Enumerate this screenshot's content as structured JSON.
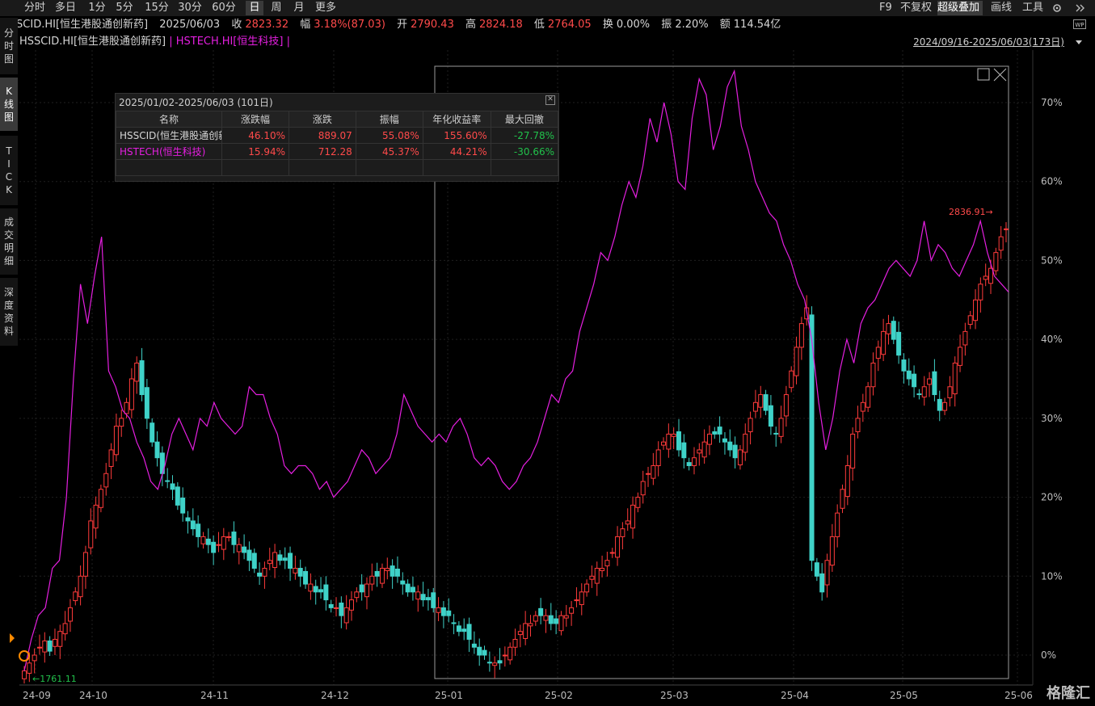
{
  "toolbar": {
    "periods": [
      "分时",
      "多日",
      "1分",
      "5分",
      "15分",
      "30分",
      "60分",
      "日",
      "周",
      "月",
      "更多"
    ],
    "active_period": "日",
    "right": [
      "F9",
      "不复权",
      "超级叠加",
      "画线",
      "工具"
    ],
    "right_active": "超级叠加"
  },
  "info": {
    "name": "HSSCID.HI[恒生港股通创新药]",
    "date": "2025/06/03",
    "close_label": "收",
    "close": "2823.32",
    "chg_label": "幅",
    "chg": "3.18%(87.03)",
    "open_label": "开",
    "open": "2790.43",
    "high_label": "高",
    "high": "2824.18",
    "low_label": "低",
    "low": "2764.05",
    "turn_label": "换",
    "turn": "0.00%",
    "amp_label": "振",
    "amp": "2.20%",
    "amt_label": "额",
    "amt": "114.54亿"
  },
  "legend": {
    "main": "HSSCID.HI[恒生港股通创新药]",
    "sep": " | ",
    "overlay": "HSTECH.HI[恒生科技]",
    "end": " |",
    "range": "2024/09/16-2025/06/03(173日)"
  },
  "leftnav": [
    {
      "label": "分时图",
      "active": false
    },
    {
      "label": "K线图",
      "active": true
    },
    {
      "label": "TICK",
      "active": false
    },
    {
      "label": "成交明细",
      "active": false
    },
    {
      "label": "深度资料",
      "active": false
    }
  ],
  "summary": {
    "title": "2025/01/02-2025/06/03 (101日)",
    "headers": [
      "名称",
      "涨跌幅",
      "涨跌",
      "振幅",
      "年化收益率",
      "最大回撤"
    ],
    "rows": [
      {
        "name": "HSSCID(恒生港股通创新药)",
        "chg_pct": "46.10%",
        "chg": "889.07",
        "amp": "55.08%",
        "annual": "155.60%",
        "mdd": "-27.78%"
      },
      {
        "name": "HSTECH(恒生科技)",
        "chg_pct": "15.94%",
        "chg": "712.28",
        "amp": "45.37%",
        "annual": "44.21%",
        "mdd": "-30.66%"
      }
    ]
  },
  "colors": {
    "up": "#ff3b3b",
    "down": "#3fd2c8",
    "overlay": "#e51fe0",
    "grid": "#1e1e1e"
  },
  "watermark": "格隆汇",
  "chart_data": {
    "type": "candlestick-with-overlay",
    "x_ticks": [
      "24-09",
      "24-10",
      "24-11",
      "24-12",
      "25-01",
      "25-02",
      "25-03",
      "25-04",
      "25-05",
      "25-06"
    ],
    "y_ticks": [
      "0%",
      "10%",
      "20%",
      "30%",
      "40%",
      "50%",
      "60%",
      "70%"
    ],
    "ylim": [
      -3,
      75
    ],
    "low_label": "1761.11",
    "high_label": "2836.91",
    "series": [
      {
        "name": "HSSCID",
        "kind": "candle",
        "closes_pct": [
          -2,
          -1,
          0,
          1,
          1.8,
          0.5,
          2,
          3,
          4,
          6,
          8,
          10,
          13,
          17,
          19,
          21,
          23,
          26,
          29,
          30,
          32,
          35,
          37,
          33,
          30,
          27,
          25,
          23,
          22,
          21,
          19,
          18,
          17,
          16,
          15,
          15,
          14,
          13,
          14,
          15,
          15,
          14,
          14,
          13,
          12,
          11,
          10,
          11,
          12,
          13,
          12,
          12,
          11,
          11,
          10,
          9,
          9,
          8,
          8,
          7,
          6,
          6,
          5,
          6,
          7,
          8,
          8,
          9,
          10,
          10,
          11,
          11,
          10,
          10,
          9,
          8,
          8,
          8,
          7,
          7,
          6,
          6,
          5,
          5,
          4,
          3,
          3,
          2,
          1,
          0,
          0,
          -1,
          -1,
          -1,
          0,
          1,
          2,
          3,
          4,
          4,
          5,
          5,
          5,
          4,
          4,
          5,
          5,
          6,
          7,
          8,
          9,
          10,
          11,
          11,
          12,
          13,
          15,
          16,
          17,
          19,
          20,
          22,
          23,
          24,
          26,
          27,
          28,
          28,
          26,
          25,
          24,
          25,
          26,
          27,
          28,
          28,
          28,
          27,
          26,
          25,
          26,
          28,
          30,
          32,
          33,
          31,
          29,
          28,
          30,
          33,
          36,
          39,
          42,
          44,
          12,
          10,
          8,
          12,
          15,
          18,
          21,
          24,
          28,
          30,
          32,
          34,
          37,
          39,
          41,
          42,
          40,
          38,
          36,
          35,
          34,
          33,
          34,
          35,
          33,
          31,
          32,
          34,
          37,
          39,
          41,
          43,
          45,
          47,
          48,
          49,
          51,
          53,
          54
        ],
        "note": "percent change vs start, estimated"
      },
      {
        "name": "HSTECH",
        "kind": "line",
        "values_pct": [
          -2,
          2,
          5,
          6,
          11,
          12,
          20,
          35,
          47,
          42,
          48,
          53,
          36,
          34,
          31,
          30,
          27,
          25,
          22,
          21,
          24,
          28,
          30,
          28,
          26,
          30,
          29,
          32,
          30,
          29,
          28,
          29,
          34,
          33,
          33,
          30,
          28,
          24,
          23,
          24,
          24,
          23,
          21,
          22,
          20,
          21,
          22,
          24,
          26,
          25,
          23,
          24,
          25,
          28,
          33,
          31,
          29,
          28,
          27,
          28,
          27,
          29,
          30,
          28,
          25,
          24,
          25,
          24,
          22,
          21,
          22,
          24,
          25,
          27,
          30,
          33,
          32,
          35,
          36,
          41,
          44,
          47,
          51,
          50,
          53,
          57,
          60,
          58,
          62,
          68,
          65,
          70,
          66,
          60,
          59,
          68,
          73,
          71,
          64,
          67,
          72,
          74,
          67,
          64,
          60,
          58,
          56,
          55,
          52,
          50,
          47,
          45,
          40,
          32,
          26,
          30,
          36,
          40,
          37,
          42,
          44,
          45,
          47,
          49,
          50,
          49,
          48,
          50,
          55,
          50,
          52,
          51,
          49,
          48,
          50,
          52,
          55,
          51,
          48,
          47,
          46
        ],
        "note": "percent change vs start, estimated"
      }
    ]
  }
}
